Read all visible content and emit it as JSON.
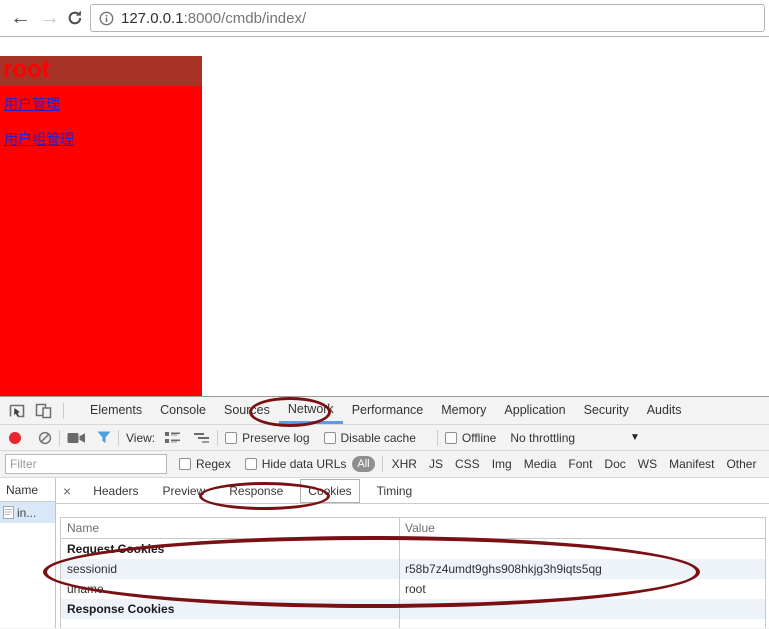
{
  "browser": {
    "url_host": "127.0.0.1",
    "url_rest": ":8000/cmdb/index/",
    "url_full": "127.0.0.1:8000/cmdb/index/"
  },
  "page": {
    "header_title": "root",
    "links": [
      {
        "label": "用户管理"
      },
      {
        "label": "用户组管理"
      }
    ],
    "colors": {
      "header_bg": "#a93226",
      "panel_bg": "#ff0000",
      "title_color": "#ff0000",
      "link_color": "#2222cc"
    }
  },
  "devtools": {
    "tabs": [
      "Elements",
      "Console",
      "Sources",
      "Network",
      "Performance",
      "Memory",
      "Application",
      "Security",
      "Audits"
    ],
    "selected_tab": "Network",
    "toolbar": {
      "view_label": "View:",
      "preserve_log_label": "Preserve log",
      "disable_cache_label": "Disable cache",
      "offline_label": "Offline",
      "throttling_value": "No throttling",
      "dropdown_arrow": "▼"
    },
    "filterbar": {
      "placeholder": "Filter",
      "regex_label": "Regex",
      "hide_data_urls_label": "Hide data URLs",
      "selected_type": "All",
      "types": [
        "XHR",
        "JS",
        "CSS",
        "Img",
        "Media",
        "Font",
        "Doc",
        "WS",
        "Manifest",
        "Other"
      ]
    },
    "requests_panel": {
      "name_header": "Name",
      "request_item": "in...",
      "close_label": "×"
    },
    "details_tabs": [
      "Headers",
      "Preview",
      "Response",
      "Cookies",
      "Timing"
    ],
    "selected_details_tab": "Cookies",
    "cookies_table": {
      "columns": [
        "Name",
        "Value"
      ],
      "rows": [
        {
          "name": "Request Cookies",
          "value": ""
        },
        {
          "name": "sessionid",
          "value": "r58b7z4umdt9ghs908hkjg3h9iqts5qg"
        },
        {
          "name": "uname",
          "value": "root"
        },
        {
          "name": "Response Cookies",
          "value": ""
        }
      ]
    },
    "colors": {
      "selected_tab_underline": "#5a9ce8",
      "record_red": "#e8262b",
      "annotation_ellipse": "#7a1014",
      "row_alt_bg": "#eef3fa",
      "selected_request_bg": "#d9e8f9"
    }
  }
}
